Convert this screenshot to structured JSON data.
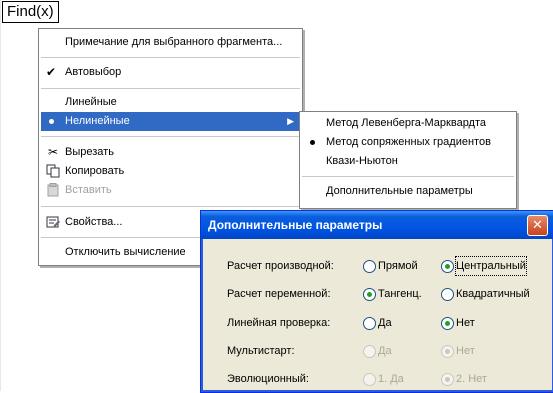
{
  "cell": {
    "formula": "Find(x)"
  },
  "context_menu": {
    "note": "Примечание для выбранного фрагмента...",
    "autoselect": "Автовыбор",
    "linear": "Линейные",
    "nonlinear": "Нелинейные",
    "cut": "Вырезать",
    "copy": "Копировать",
    "paste": "Вставить",
    "properties": "Свойства...",
    "disable_calc": "Отключить вычисление"
  },
  "submenu": {
    "lm": "Метод Левенберга-Марквардта",
    "cg": "Метод сопряженных градиентов",
    "qn": "Квази-Ньютон",
    "advanced": "Дополнительные параметры"
  },
  "dialog": {
    "title": "Дополнительные параметры",
    "close": "✕",
    "rows": {
      "derivative": {
        "label": "Расчет производной:",
        "opt1": "Прямой",
        "opt2": "Центральный"
      },
      "variable": {
        "label": "Расчет переменной:",
        "opt1": "Тангенц.",
        "opt2": "Квадратичный"
      },
      "linesearch": {
        "label": "Линейная проверка:",
        "opt1": "Да",
        "opt2": "Нет"
      },
      "multistart": {
        "label": "Мультистарт:",
        "opt1": "Да",
        "opt2": "Нет"
      },
      "evolutionary": {
        "label": "Эволюционный:",
        "opt1": "1. Да",
        "opt2": "2. Нет"
      }
    }
  },
  "colors": {
    "highlight": "#316ac5",
    "dialog_bg": "#ece9d8",
    "title_blue": "#0055e5",
    "close_red": "#c7431c"
  }
}
